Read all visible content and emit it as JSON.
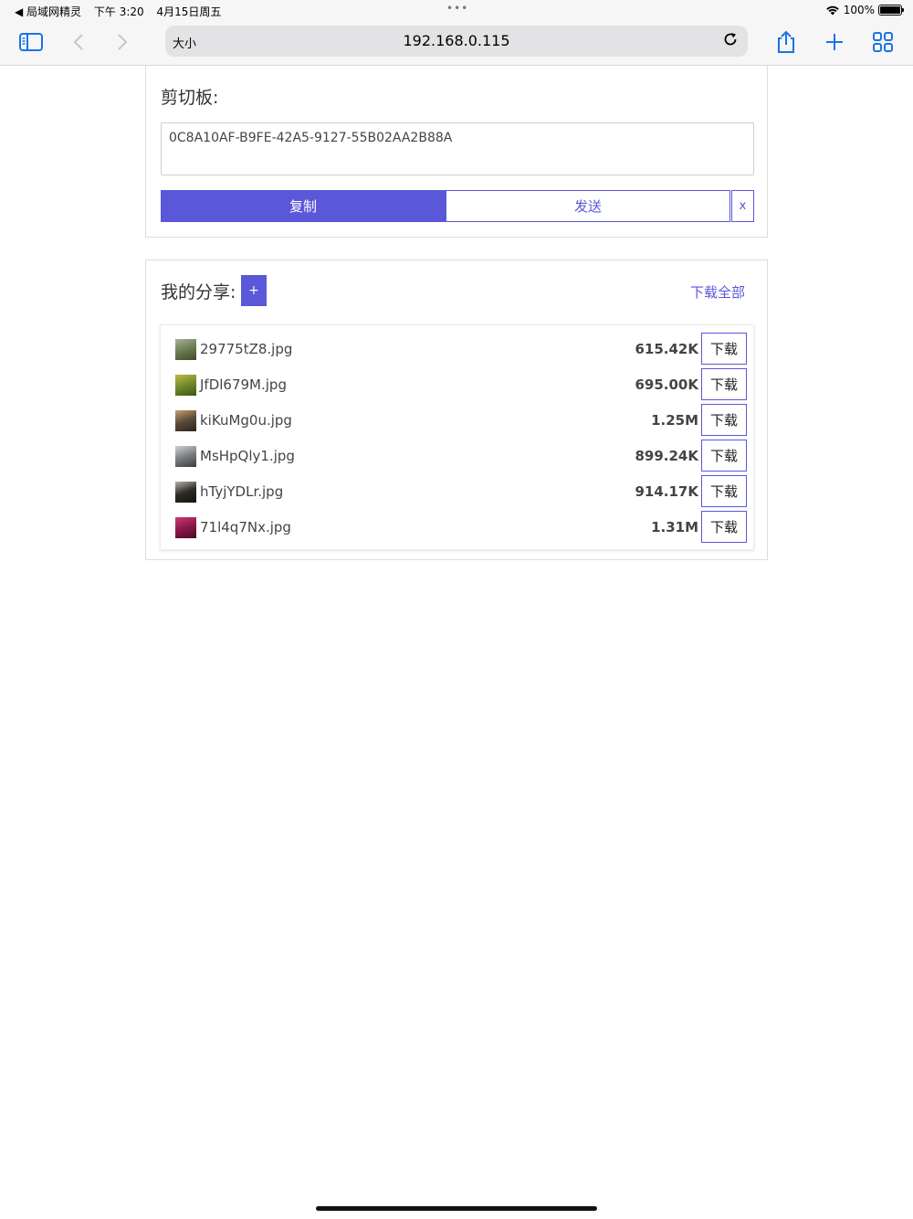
{
  "status_bar": {
    "back_app": "◀ 局域网精灵",
    "time": "下午 3:20",
    "date": "4月15日周五",
    "dots": "•••",
    "battery_pct": "100%"
  },
  "browser": {
    "reader_label": "大小",
    "url": "192.168.0.115"
  },
  "clipboard": {
    "title": "剪切板:",
    "value": "0C8A10AF-B9FE-42A5-9127-55B02AA2B88A",
    "copy_label": "复制",
    "send_label": "发送",
    "close_label": "x"
  },
  "share": {
    "title": "我的分享:",
    "add_label": "+",
    "download_all_label": "下载全部",
    "download_label": "下载",
    "files": [
      {
        "name": "29775tZ8.jpg",
        "size": "615.42K",
        "thumb_colors": [
          "#6b7d4f",
          "#a8b1a0",
          "#3e4a2c"
        ]
      },
      {
        "name": "JfDl679M.jpg",
        "size": "695.00K",
        "thumb_colors": [
          "#6e8a2a",
          "#c3b84a",
          "#3d5418"
        ]
      },
      {
        "name": "kiKuMg0u.jpg",
        "size": "1.25M",
        "thumb_colors": [
          "#5a4a3a",
          "#c8a070",
          "#2c241c"
        ]
      },
      {
        "name": "MsHpQly1.jpg",
        "size": "899.24K",
        "thumb_colors": [
          "#7a7e80",
          "#d0d2d0",
          "#3a3c3e"
        ]
      },
      {
        "name": "hTyjYDLr.jpg",
        "size": "914.17K",
        "thumb_colors": [
          "#2e2a26",
          "#b8b2a8",
          "#141210"
        ]
      },
      {
        "name": "71l4q7Nx.jpg",
        "size": "1.31M",
        "thumb_colors": [
          "#8a1848",
          "#d03a78",
          "#4a0c28"
        ]
      }
    ]
  }
}
